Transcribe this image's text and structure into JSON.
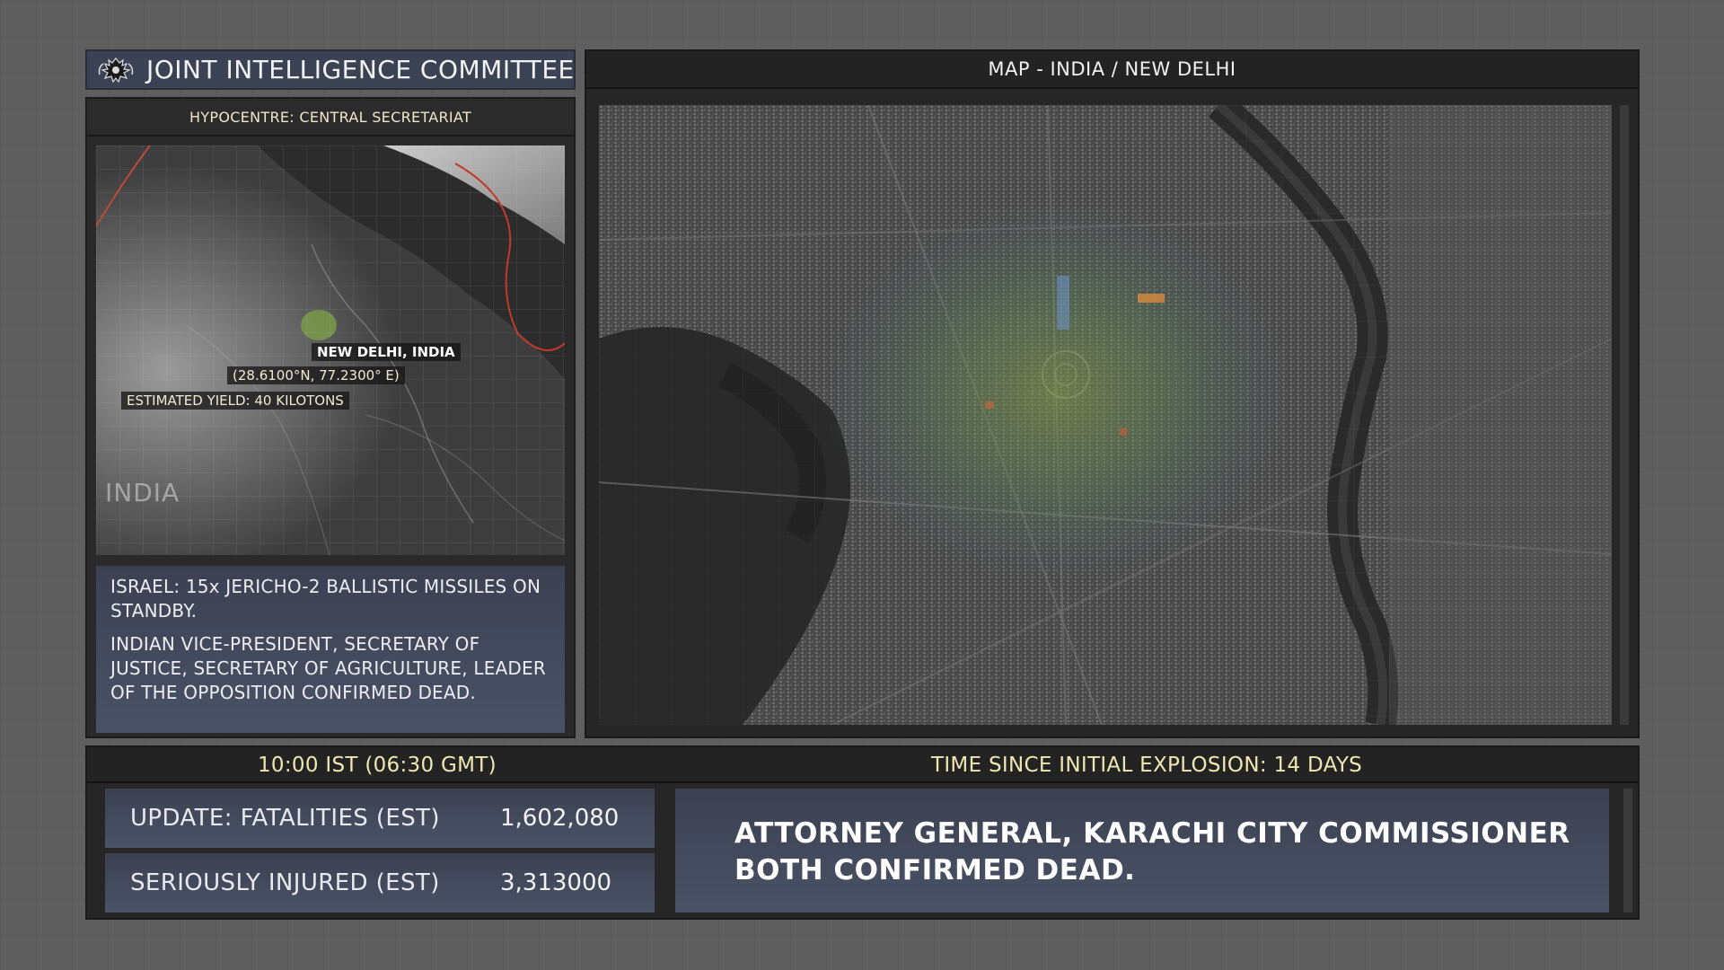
{
  "header": {
    "title": "JOINT INTELLIGENCE COMMITTEE",
    "crest_icon": "royal-crest-icon"
  },
  "left_panel": {
    "hypocentre_label": "HYPOCENTRE: CENTRAL SECRETARIAT",
    "map": {
      "city_label": "NEW DELHI, INDIA",
      "coordinates": "(28.6100°N, 77.2300° E)",
      "yield_label": "ESTIMATED YIELD: 40 KILOTONS",
      "country_label": "INDIA"
    },
    "briefings": [
      "ISRAEL: 15x JERICHO-2 BALLISTIC MISSILES ON STANDBY.",
      "INDIAN VICE-PRESIDENT, SECRETARY OF JUSTICE, SECRETARY OF AGRICULTURE, LEADER OF THE OPPOSITION CONFIRMED DEAD."
    ]
  },
  "map_panel": {
    "title": "MAP - INDIA / NEW DELHI"
  },
  "bottom": {
    "local_time": "10:00 IST (06:30 GMT)",
    "time_since": "TIME SINCE INITIAL EXPLOSION: 14 DAYS",
    "stats": [
      {
        "label": "UPDATE: FATALITIES (EST)",
        "value": "1,602,080"
      },
      {
        "label": "SERIOUSLY INJURED (EST)",
        "value": "3,313000"
      }
    ],
    "alert": "ATTORNEY GENERAL, KARACHI CITY COMMISSIONER BOTH CONFIRMED DEAD."
  },
  "colors": {
    "accent_panel": "#3b4152",
    "highlight_text": "#efe7b0",
    "background": "#5f5f5f"
  }
}
